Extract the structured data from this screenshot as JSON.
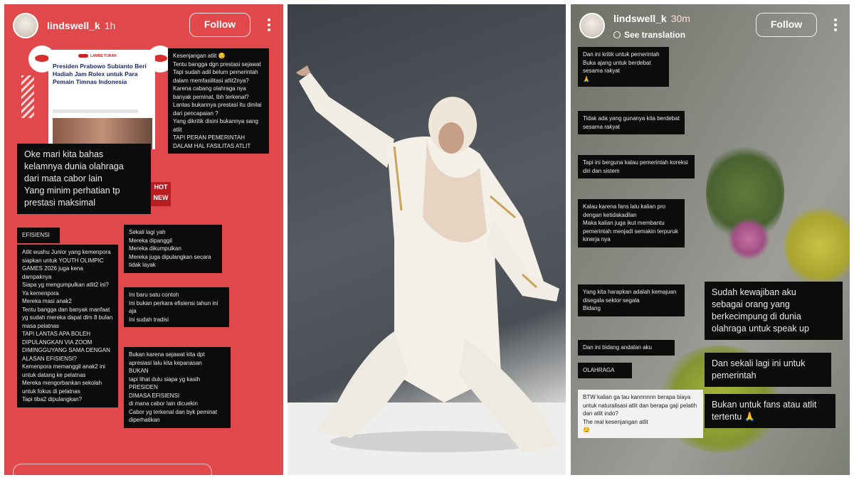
{
  "story_left": {
    "username": "lindswell_k",
    "time": "1h",
    "follow_label": "Follow",
    "news": {
      "brand": "LAMBE TURAH",
      "title": "Presiden Prabowo Subianto Beri Hadiah Jam Rolex untuk Para Pemain Timnas Indonesia"
    },
    "badge_text": "HOT NEW",
    "notes": {
      "kesenjangan": "Kesenjangan atlit 😏\nTentu bangga dgn prestasi sejawat\nTapi sudah adil belum pemerintah dalam memfasilitasi atlit2nya?\nKarena cabang olahraga nya banyak peminat, lbh terkenal?\nLantas bukannya prestasi itu dinilai dari pencapaian ?\nYang dikritik disini bukannya sang atlit\nTAPI PERAN PEMERINTAH DALAM HAL FASILITAS ATLIT",
      "headline": "Oke mari kita bahas\nkelamnya dunia olahraga\ndari mata cabor lain\nYang minim perhatian tp\nprestasi maksimal",
      "efisiensi_label": "EFISIENSI",
      "wushu": "Atlit wushu Junior yang kemenpora siapkan untuk YOUTH OLIMPIC GAMES 2026 juga kena dampaknya\nSiapa yg mengumpulkan atlit2 ini?\nYa kemenpora\nMereka masi anak2\nTentu bangga dan banyak manfaat yg sudah mereka dapat dlm 8 bulan masa pelatnas\nTAPI LANTAS APA BOLEH DIPULANGKAN VIA ZOOM DIMINGGUYANG SAMA DENGAN ALASAN EFISIENSI?\nKemenpora memanggil anak2 ini untuk datang ke pelatnas\nMereka mengorbankan sekolah untuk fokus di pelatnas\nTapi tiba2 dipulangkan?",
      "sekali": "Sekali lagi yah\nMereka dipanggil\nMereka dikumpulkan\nMereka juga dipulangkan secara tidak layak",
      "contoh": "Ini baru satu contoh\nIni bukan perkara efisiensi tahun ini aja\nIni sudah tradisi",
      "bukan": "Bukan karena sejawat kita dpt apresiasi lalu kita kepanasan\nBUKAN\ntapi lihat dulu siapa yg kasih\nPRESIDEN\nDIMASA EFISIENSI\ndi mana cabor lain dicuekin\nCabor yg terkenal dan byk peminat diperhatikan"
    }
  },
  "story_right": {
    "username": "lindswell_k",
    "time": "30m",
    "translate_label": "See translation",
    "follow_label": "Follow",
    "notes": {
      "n1": "Dan ini kritik untuk pemerintah\nBuka ajang untuk berdebat sesama rakyat\n🙏",
      "n2": "Tidak ada yang gunanya kita berdebat sesama rakyat",
      "n3": "Tapi ini berguna kalau pemerintah koreksi diri dan sistem",
      "n4": "Kalau karena fans lalu kalian pro dengan ketidakadilan\nMaka kalian juga ikut membantu pemerintah menjadi semakin terpuruk kinerja nya",
      "n5": "Yang kita harapkan adalah kemajuan disegala sektor segala\nBidang",
      "n6": "Dan ini bidang andalan aku",
      "n7": "OLAHRAGA",
      "n8": "BTW kalian ga tau kannnnnn berapa biaya untuk naturalisasi atlit dan berapa gaji pelatih dan atlit indo?\nThe real kesenjangan atlit\n😏",
      "big1": "Sudah kewajiban aku\nsebagai orang yang\nberkecimpung di dunia\nolahraga untuk speak up",
      "big2": "Dan sekali lagi ini untuk\npemerintah",
      "big3": "Bukan untuk fans atau atlit\ntertentu 🙏"
    }
  },
  "colors": {
    "story_left_bg": "#e0484c",
    "note_bg": "#0c0c0c",
    "note_text": "#e9e9e9"
  }
}
